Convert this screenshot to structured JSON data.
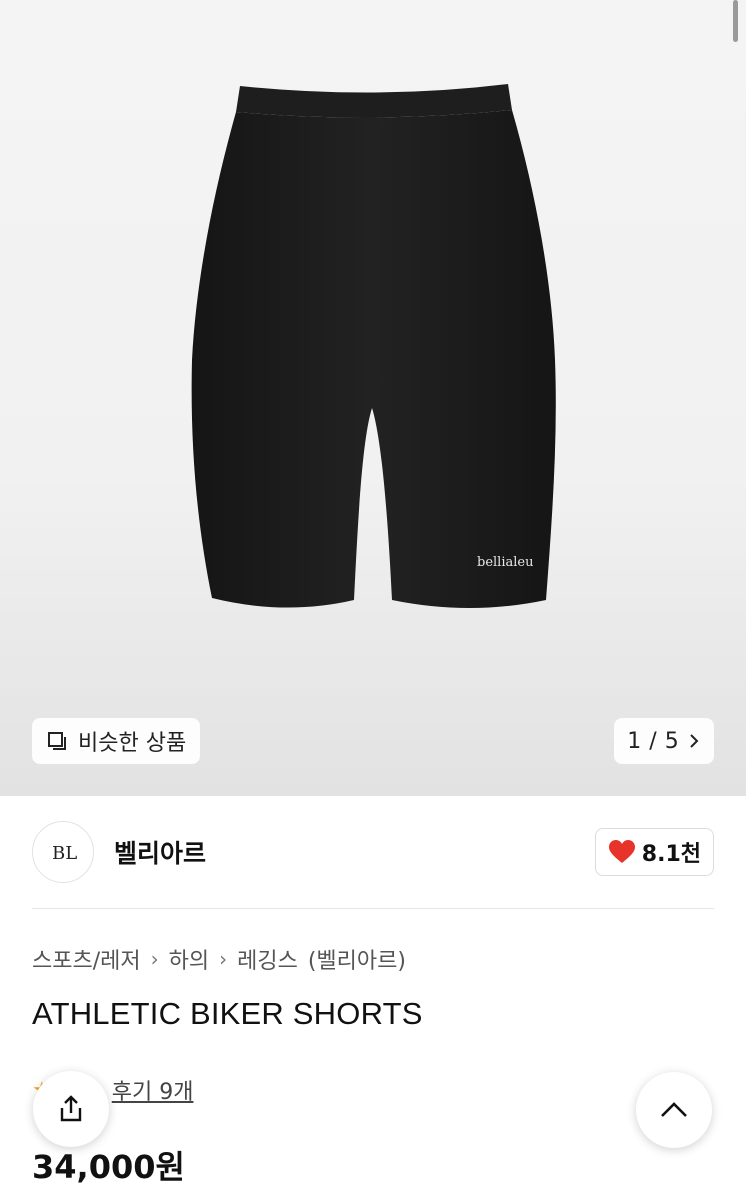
{
  "gallery": {
    "similar_label": "비슷한 상품",
    "pager_current": "1",
    "pager_total": "5",
    "pager_separator": "/",
    "product_print": "bellialeu"
  },
  "brand": {
    "logo_text": "BL",
    "name": "벨리아르",
    "like_count": "8.1천"
  },
  "breadcrumb": {
    "items": [
      "스포츠/레저",
      "하의",
      "레깅스"
    ],
    "brand_paren": "(벨리아르)"
  },
  "product": {
    "title": "ATHLETIC BIKER SHORTS",
    "rating_star": "★",
    "review_link": "후기 9개",
    "price": "34,000원"
  },
  "colors": {
    "heart": "#e8332a",
    "star": "#f5a623",
    "shorts": "#1b1b1b"
  }
}
